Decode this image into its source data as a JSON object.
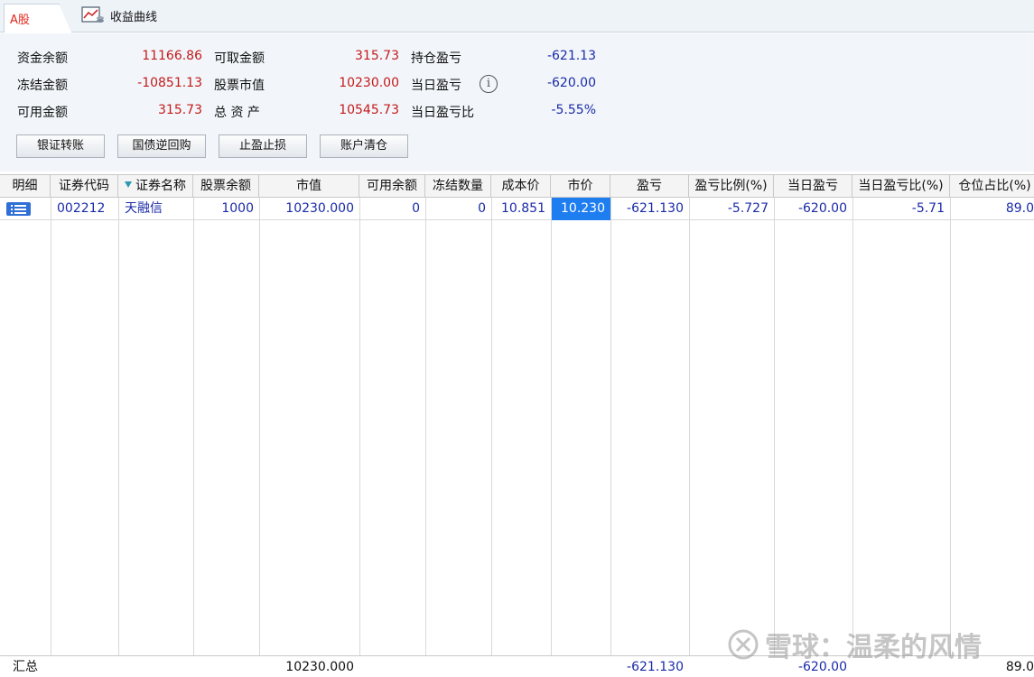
{
  "tabs": {
    "stock": "A股",
    "curve": "收益曲线"
  },
  "summary": {
    "col1": [
      {
        "label": "资金余额",
        "value": "11166.86"
      },
      {
        "label": "冻结金额",
        "value": "-10851.13"
      },
      {
        "label": "可用金额",
        "value": "315.73"
      }
    ],
    "col2": [
      {
        "label": "可取金额",
        "value": "315.73"
      },
      {
        "label": "股票市值",
        "value": "10230.00"
      },
      {
        "label": "总 资 产",
        "value": "10545.73"
      }
    ],
    "col3": [
      {
        "label": "持仓盈亏",
        "value": "-621.13"
      },
      {
        "label": "当日盈亏",
        "value": "-620.00"
      },
      {
        "label": "当日盈亏比",
        "value": "-5.55%"
      }
    ]
  },
  "buttons": {
    "transfer": "银证转账",
    "repo": "国债逆回购",
    "stop": "止盈止损",
    "clear": "账户清仓"
  },
  "table": {
    "headers": [
      "明细",
      "证券代码",
      "证券名称",
      "股票余额",
      "市值",
      "可用余额",
      "冻结数量",
      "成本价",
      "市价",
      "盈亏",
      "盈亏比例(%)",
      "当日盈亏",
      "当日盈亏比(%)",
      "仓位占比(%)"
    ],
    "row": {
      "code": "002212",
      "name": "天融信",
      "balance": "1000",
      "market_value": "10230.000",
      "available": "0",
      "frozen": "0",
      "cost": "10.851",
      "price": "10.230",
      "pnl": "-621.130",
      "pnl_pct": "-5.727",
      "day_pnl": "-620.00",
      "day_pnl_pct": "-5.71",
      "position_pct": "89.0"
    },
    "total": {
      "label": "汇总",
      "market_value": "10230.000",
      "pnl": "-621.130",
      "day_pnl": "-620.00",
      "position_pct": "89.0"
    }
  },
  "watermark": "雪球：温柔的风情"
}
